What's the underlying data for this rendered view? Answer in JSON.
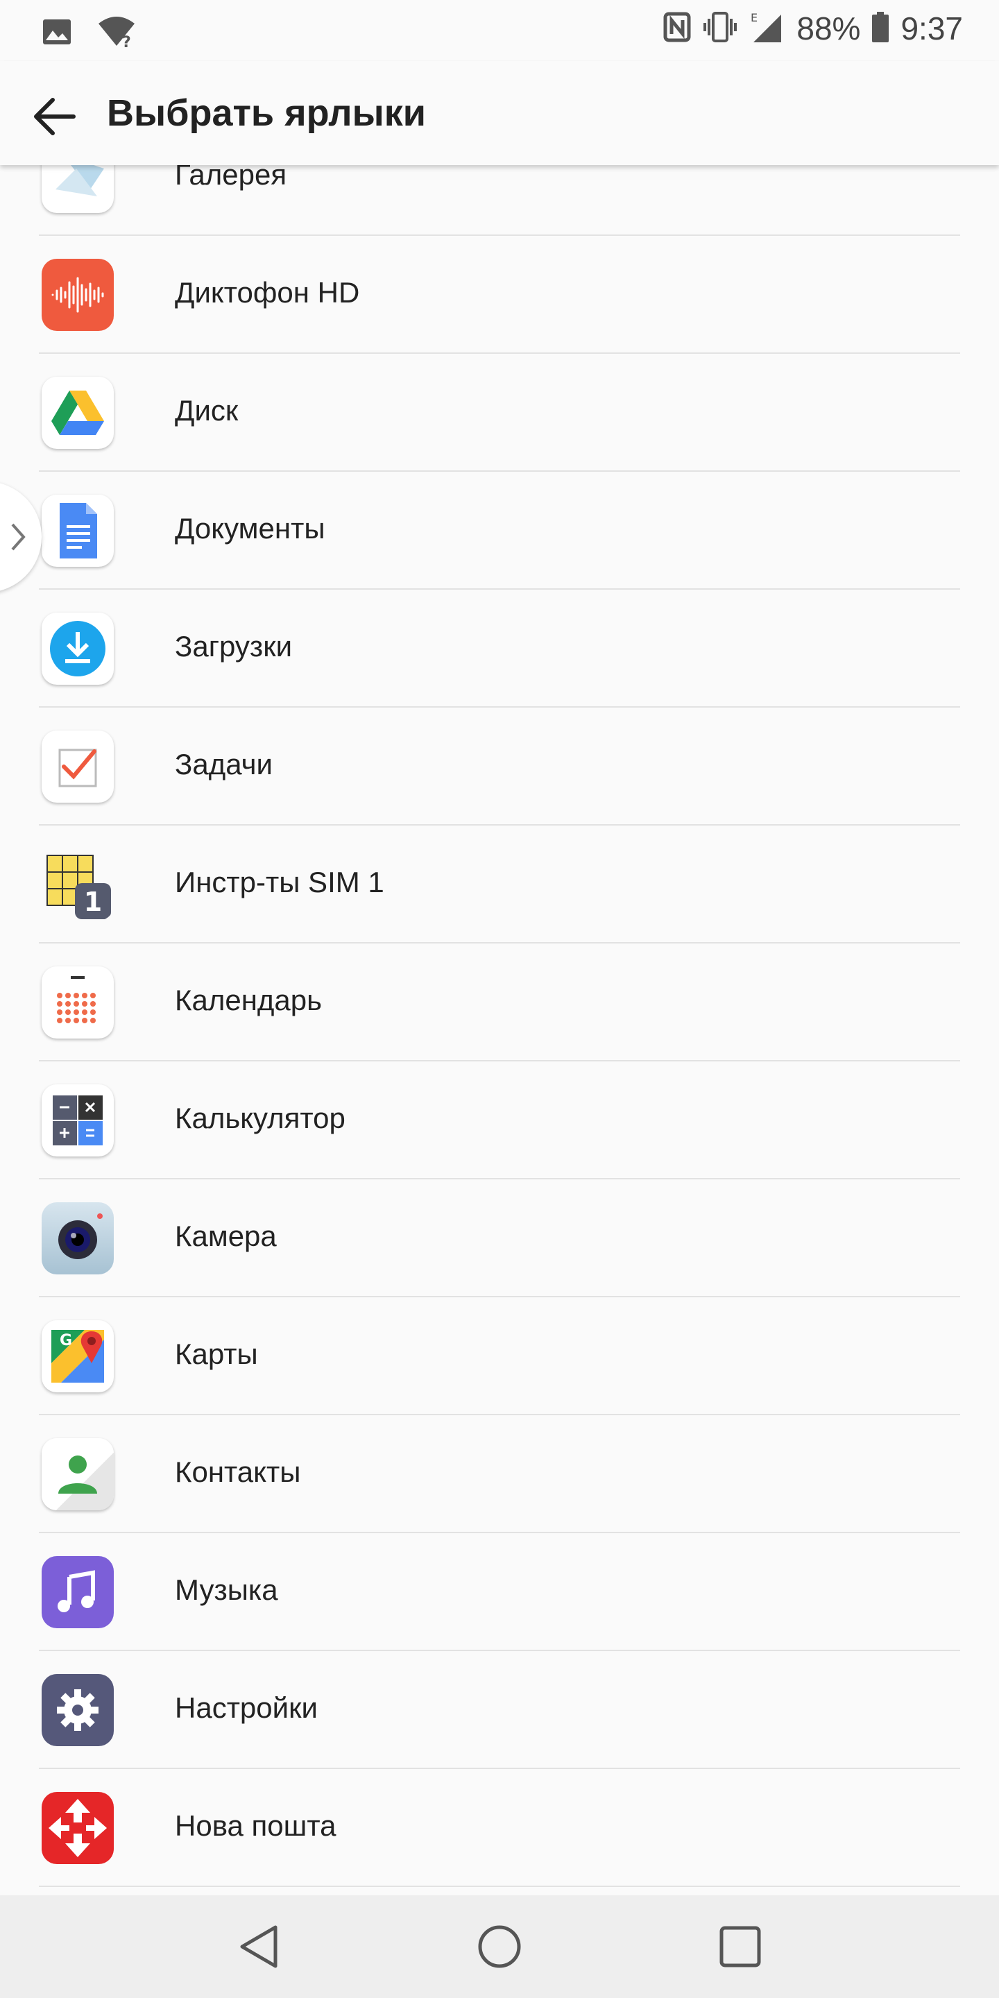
{
  "status_bar": {
    "battery_percent": "88%",
    "time": "9:37",
    "network_type": "E",
    "icons": [
      "image-icon",
      "wifi-unknown-icon",
      "nfc-icon",
      "vibrate-icon",
      "signal-icon",
      "battery-icon"
    ]
  },
  "app_bar": {
    "title": "Выбрать ярлыки",
    "back_icon": "arrow-back-icon"
  },
  "list": {
    "items": [
      {
        "label": "Галерея",
        "icon": "gallery-icon"
      },
      {
        "label": "Диктофон HD",
        "icon": "voice-recorder-icon"
      },
      {
        "label": "Диск",
        "icon": "google-drive-icon"
      },
      {
        "label": "Документы",
        "icon": "google-docs-icon"
      },
      {
        "label": "Загрузки",
        "icon": "downloads-icon"
      },
      {
        "label": "Задачи",
        "icon": "tasks-icon"
      },
      {
        "label": "Инстр-ты SIM 1",
        "icon": "sim-toolkit-icon"
      },
      {
        "label": "Календарь",
        "icon": "calendar-icon"
      },
      {
        "label": "Калькулятор",
        "icon": "calculator-icon"
      },
      {
        "label": "Камера",
        "icon": "camera-icon"
      },
      {
        "label": "Карты",
        "icon": "google-maps-icon"
      },
      {
        "label": "Контакты",
        "icon": "contacts-icon"
      },
      {
        "label": "Музыка",
        "icon": "music-icon"
      },
      {
        "label": "Настройки",
        "icon": "settings-icon"
      },
      {
        "label": "Нова пошта",
        "icon": "nova-poshta-icon"
      },
      {
        "label": "",
        "icon": "partial-app-icon"
      }
    ]
  },
  "nav_bar": {
    "icons": [
      "nav-back-icon",
      "nav-home-icon",
      "nav-recents-icon"
    ]
  },
  "colors": {
    "background": "#fafafa",
    "divider": "#e2e2e2",
    "nav_bar": "#eeeeee",
    "recorder_red": "#ef5a3e",
    "music_purple": "#7c5fd8",
    "settings_indigo": "#55587a",
    "nova_red": "#e52628"
  }
}
